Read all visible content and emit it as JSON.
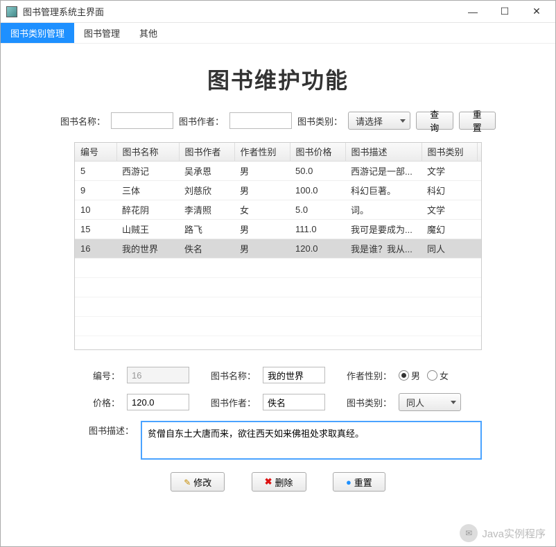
{
  "window": {
    "title": "图书管理系统主界面"
  },
  "menubar": {
    "items": [
      {
        "label": "图书类别管理",
        "active": true
      },
      {
        "label": "图书管理",
        "active": false
      },
      {
        "label": "其他",
        "active": false
      }
    ]
  },
  "page_title": "图书维护功能",
  "search": {
    "name_label": "图书名称：",
    "name_value": "",
    "author_label": "图书作者：",
    "author_value": "",
    "category_label": "图书类别：",
    "category_selected": "请选择",
    "query_btn": "查询",
    "reset_btn": "重置"
  },
  "table": {
    "columns": [
      "编号",
      "图书名称",
      "图书作者",
      "作者性别",
      "图书价格",
      "图书描述",
      "图书类别"
    ],
    "plus": "+",
    "rows": [
      {
        "id": "5",
        "name": "西游记",
        "author": "吴承恩",
        "gender": "男",
        "price": "50.0",
        "desc": "西游记是一部...",
        "category": "文学",
        "selected": false
      },
      {
        "id": "9",
        "name": "三体",
        "author": "刘慈欣",
        "gender": "男",
        "price": "100.0",
        "desc": "科幻巨著。",
        "category": "科幻",
        "selected": false
      },
      {
        "id": "10",
        "name": "醉花阴",
        "author": "李清照",
        "gender": "女",
        "price": "5.0",
        "desc": "词。",
        "category": "文学",
        "selected": false
      },
      {
        "id": "15",
        "name": "山贼王",
        "author": "路飞",
        "gender": "男",
        "price": "111.0",
        "desc": "我可是要成为...",
        "category": "魔幻",
        "selected": false
      },
      {
        "id": "16",
        "name": "我的世界",
        "author": "佚名",
        "gender": "男",
        "price": "120.0",
        "desc": "我是谁？我从...",
        "category": "同人",
        "selected": true
      }
    ]
  },
  "form": {
    "id_label": "编号：",
    "id_value": "16",
    "name_label": "图书名称：",
    "name_value": "我的世界",
    "gender_label": "作者性别：",
    "gender_male": "男",
    "gender_female": "女",
    "gender_value": "男",
    "price_label": "价格：",
    "price_value": "120.0",
    "author_label": "图书作者：",
    "author_value": "佚名",
    "category_label": "图书类别：",
    "category_value": "同人",
    "desc_label": "图书描述：",
    "desc_value": "贫僧自东土大唐而来，欲往西天如来佛祖处求取真经。"
  },
  "actions": {
    "modify": "修改",
    "delete": "删除",
    "reset": "重置"
  },
  "watermark": "Java实例程序"
}
